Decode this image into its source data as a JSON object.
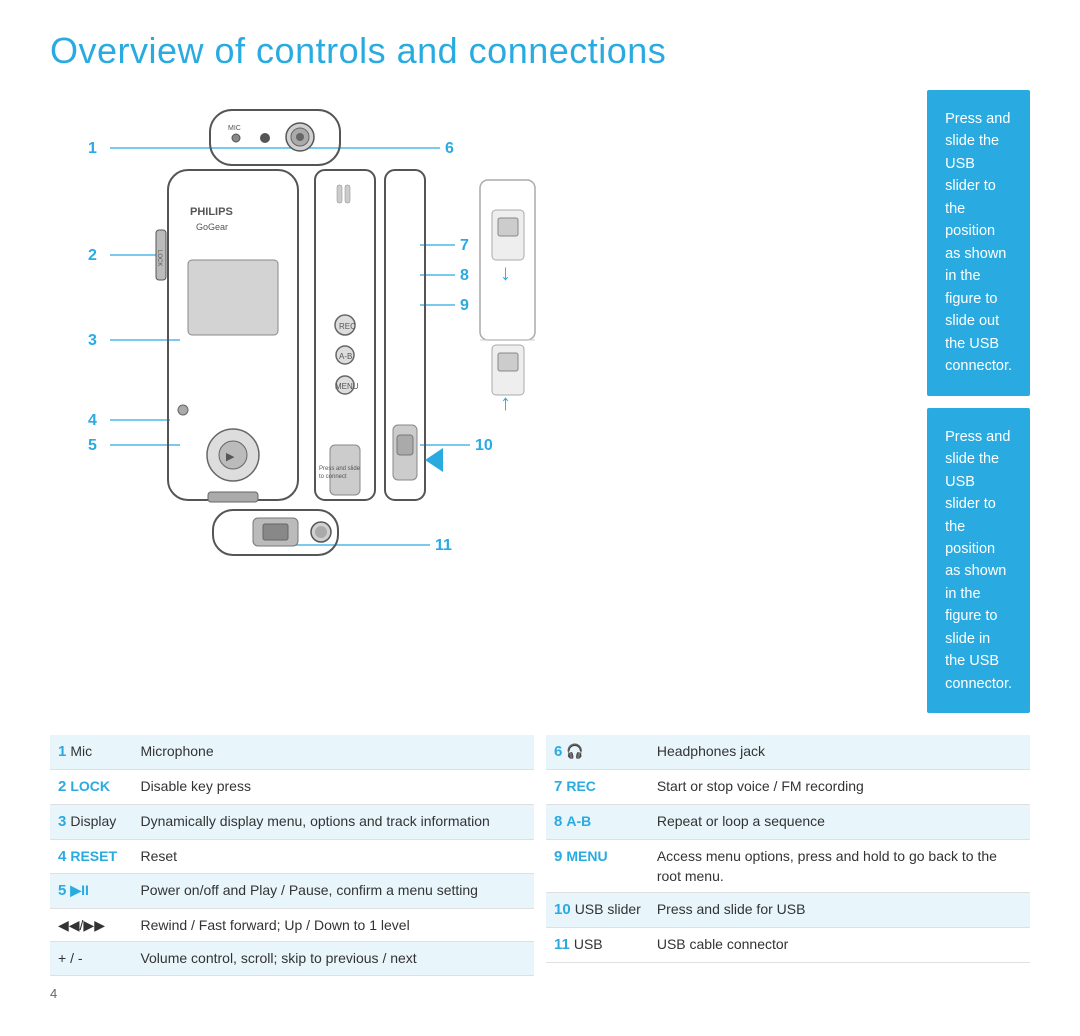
{
  "title": "Overview of controls and connections",
  "callouts": [
    {
      "id": "callout1",
      "text": "Press and slide the USB slider to the position as shown in the figure to slide out the USB connector."
    },
    {
      "id": "callout2",
      "text": "Press and slide the USB slider to the position as shown in the figure to slide in the USB connector."
    }
  ],
  "labels": {
    "1": "1",
    "2": "2",
    "3": "3",
    "4": "4",
    "5": "5",
    "6": "6",
    "7": "7",
    "8": "8",
    "9": "9",
    "10": "10",
    "11": "11"
  },
  "tableLeft": [
    {
      "num": "1",
      "name": "Mic",
      "nameStyle": "normal",
      "desc": "Microphone"
    },
    {
      "num": "2",
      "name": "LOCK",
      "nameStyle": "blue",
      "desc": "Disable key press"
    },
    {
      "num": "3",
      "name": "Display",
      "nameStyle": "normal",
      "desc": "Dynamically display menu, options and track information"
    },
    {
      "num": "4",
      "name": "RESET",
      "nameStyle": "blue",
      "desc": "Reset"
    },
    {
      "num": "5",
      "name": "▶II",
      "nameStyle": "blue",
      "desc": "Power on/off and Play / Pause, confirm a menu setting"
    },
    {
      "num": "",
      "name": "◀◀/▶▶",
      "nameStyle": "normal",
      "desc": "Rewind / Fast forward; Up / Down to 1 level"
    },
    {
      "num": "",
      "name": "+ / -",
      "nameStyle": "normal",
      "desc": "Volume control, scroll; skip to previous / next"
    }
  ],
  "tableRight": [
    {
      "num": "6",
      "name": "🎧",
      "nameStyle": "normal",
      "desc": "Headphones jack"
    },
    {
      "num": "7",
      "name": "REC",
      "nameStyle": "blue",
      "desc": "Start or stop voice / FM recording"
    },
    {
      "num": "8",
      "name": "A-B",
      "nameStyle": "blue",
      "desc": "Repeat or loop a sequence"
    },
    {
      "num": "9",
      "name": "MENU",
      "nameStyle": "blue",
      "desc": "Access menu options, press and hold to go back to the root menu."
    },
    {
      "num": "10",
      "name": "USB slider",
      "nameStyle": "normal",
      "desc": "Press and slide for USB"
    },
    {
      "num": "11",
      "name": "USB",
      "nameStyle": "normal",
      "desc": "USB cable connector"
    }
  ],
  "pageNumber": "4"
}
